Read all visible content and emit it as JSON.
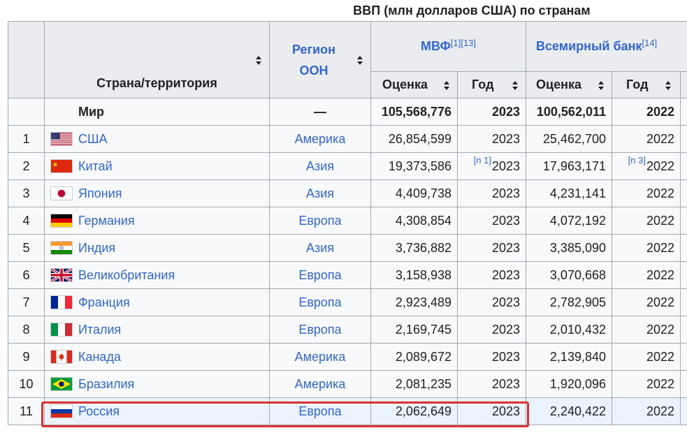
{
  "caption": "ВВП (млн долларов США) по странам",
  "headers": {
    "country": "Страна/территория",
    "region_line1": "Регион",
    "region_line2": "ООН",
    "imf": "МВФ",
    "imf_refs": "[1][13]",
    "wb": "Всемирный банк",
    "wb_refs": "[14]",
    "estimate": "Оценка",
    "year": "Год"
  },
  "world": {
    "name": "Мир",
    "region": "—",
    "imf_value": "105,568,776",
    "imf_year": "2023",
    "wb_value": "100,562,011",
    "wb_year": "2022"
  },
  "rows": [
    {
      "rank": "1",
      "flag": "us-flag",
      "country": "США",
      "region": "Америка",
      "imf_value": "26,854,599",
      "imf_note": "",
      "imf_year": "2023",
      "wb_value": "25,462,700",
      "wb_note": "",
      "wb_year": "2022"
    },
    {
      "rank": "2",
      "flag": "china-flag",
      "country": "Китай",
      "region": "Азия",
      "imf_value": "19,373,586",
      "imf_note": "[n 1]",
      "imf_year": "2023",
      "wb_value": "17,963,171",
      "wb_note": "[n 3]",
      "wb_year": "2022"
    },
    {
      "rank": "3",
      "flag": "japan-flag",
      "country": "Япония",
      "region": "Азия",
      "imf_value": "4,409,738",
      "imf_note": "",
      "imf_year": "2023",
      "wb_value": "4,231,141",
      "wb_note": "",
      "wb_year": "2022"
    },
    {
      "rank": "4",
      "flag": "germany-flag",
      "country": "Германия",
      "region": "Европа",
      "imf_value": "4,308,854",
      "imf_note": "",
      "imf_year": "2023",
      "wb_value": "4,072,192",
      "wb_note": "",
      "wb_year": "2022"
    },
    {
      "rank": "5",
      "flag": "india-flag",
      "country": "Индия",
      "region": "Азия",
      "imf_value": "3,736,882",
      "imf_note": "",
      "imf_year": "2023",
      "wb_value": "3,385,090",
      "wb_note": "",
      "wb_year": "2022"
    },
    {
      "rank": "6",
      "flag": "uk-flag",
      "country": "Великобритания",
      "region": "Европа",
      "imf_value": "3,158,938",
      "imf_note": "",
      "imf_year": "2023",
      "wb_value": "3,070,668",
      "wb_note": "",
      "wb_year": "2022"
    },
    {
      "rank": "7",
      "flag": "france-flag",
      "country": "Франция",
      "region": "Европа",
      "imf_value": "2,923,489",
      "imf_note": "",
      "imf_year": "2023",
      "wb_value": "2,782,905",
      "wb_note": "",
      "wb_year": "2022"
    },
    {
      "rank": "8",
      "flag": "italy-flag",
      "country": "Италия",
      "region": "Европа",
      "imf_value": "2,169,745",
      "imf_note": "",
      "imf_year": "2023",
      "wb_value": "2,010,432",
      "wb_note": "",
      "wb_year": "2022"
    },
    {
      "rank": "9",
      "flag": "canada-flag",
      "country": "Канада",
      "region": "Америка",
      "imf_value": "2,089,672",
      "imf_note": "",
      "imf_year": "2023",
      "wb_value": "2,139,840",
      "wb_note": "",
      "wb_year": "2022"
    },
    {
      "rank": "10",
      "flag": "brazil-flag",
      "country": "Бразилия",
      "region": "Америка",
      "imf_value": "2,081,235",
      "imf_note": "",
      "imf_year": "2023",
      "wb_value": "1,920,096",
      "wb_note": "",
      "wb_year": "2022"
    },
    {
      "rank": "11",
      "flag": "russia-flag",
      "country": "Россия",
      "region": "Европа",
      "imf_value": "2,062,649",
      "imf_note": "",
      "imf_year": "2023",
      "wb_value": "2,240,422",
      "wb_note": "",
      "wb_year": "2022"
    }
  ],
  "colors": {
    "link": "#3366cc",
    "header_bg": "#eaecf0",
    "highlight": "#d9322f"
  }
}
